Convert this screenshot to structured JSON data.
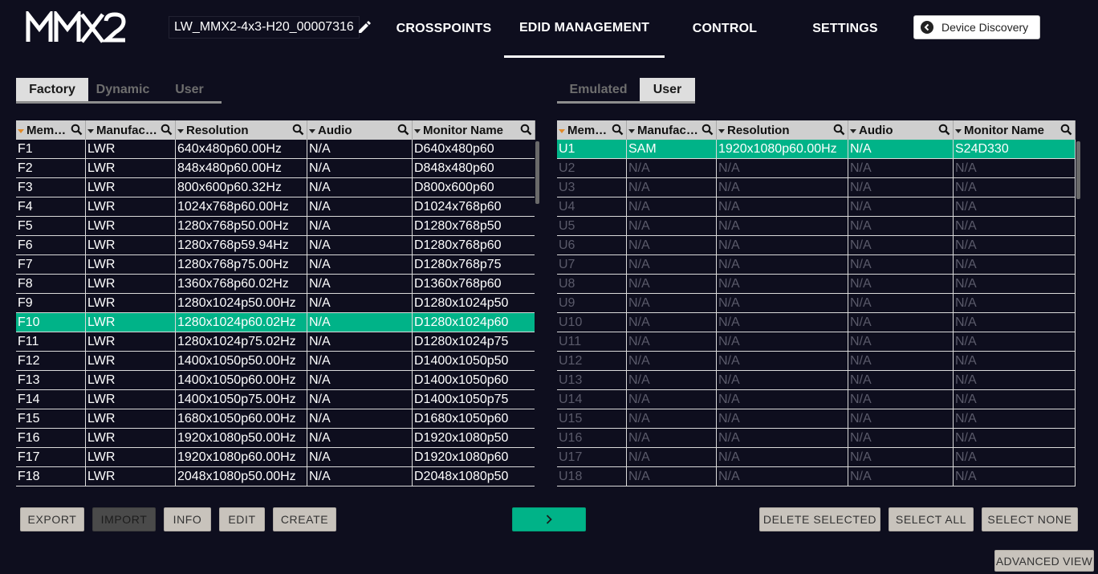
{
  "header": {
    "logo_text": "MMX2",
    "device_name": "LW_MMX2-4x3-H20_00007316",
    "nav": [
      "CROSSPOINTS",
      "EDID MANAGEMENT",
      "CONTROL",
      "SETTINGS"
    ],
    "active_nav": "EDID MANAGEMENT",
    "discovery_label": "Device Discovery"
  },
  "left_panel": {
    "tabs": [
      "Factory",
      "Dynamic",
      "User"
    ],
    "active_tab": "Factory",
    "columns": [
      "Mem…",
      "Manufac…",
      "Resolution",
      "Audio",
      "Monitor Name"
    ],
    "rows": [
      [
        "F1",
        "LWR",
        "640x480p60.00Hz",
        "N/A",
        "D640x480p60"
      ],
      [
        "F2",
        "LWR",
        "848x480p60.00Hz",
        "N/A",
        "D848x480p60"
      ],
      [
        "F3",
        "LWR",
        "800x600p60.32Hz",
        "N/A",
        "D800x600p60"
      ],
      [
        "F4",
        "LWR",
        "1024x768p60.00Hz",
        "N/A",
        "D1024x768p60"
      ],
      [
        "F5",
        "LWR",
        "1280x768p50.00Hz",
        "N/A",
        "D1280x768p50"
      ],
      [
        "F6",
        "LWR",
        "1280x768p59.94Hz",
        "N/A",
        "D1280x768p60"
      ],
      [
        "F7",
        "LWR",
        "1280x768p75.00Hz",
        "N/A",
        "D1280x768p75"
      ],
      [
        "F8",
        "LWR",
        "1360x768p60.02Hz",
        "N/A",
        "D1360x768p60"
      ],
      [
        "F9",
        "LWR",
        "1280x1024p50.00Hz",
        "N/A",
        "D1280x1024p50"
      ],
      [
        "F10",
        "LWR",
        "1280x1024p60.02Hz",
        "N/A",
        "D1280x1024p60"
      ],
      [
        "F11",
        "LWR",
        "1280x1024p75.02Hz",
        "N/A",
        "D1280x1024p75"
      ],
      [
        "F12",
        "LWR",
        "1400x1050p50.00Hz",
        "N/A",
        "D1400x1050p50"
      ],
      [
        "F13",
        "LWR",
        "1400x1050p60.00Hz",
        "N/A",
        "D1400x1050p60"
      ],
      [
        "F14",
        "LWR",
        "1400x1050p75.00Hz",
        "N/A",
        "D1400x1050p75"
      ],
      [
        "F15",
        "LWR",
        "1680x1050p60.00Hz",
        "N/A",
        "D1680x1050p60"
      ],
      [
        "F16",
        "LWR",
        "1920x1080p50.00Hz",
        "N/A",
        "D1920x1080p50"
      ],
      [
        "F17",
        "LWR",
        "1920x1080p60.00Hz",
        "N/A",
        "D1920x1080p60"
      ],
      [
        "F18",
        "LWR",
        "2048x1080p50.00Hz",
        "N/A",
        "D2048x1080p50"
      ]
    ],
    "selected_row": "F10"
  },
  "right_panel": {
    "tabs": [
      "Emulated",
      "User"
    ],
    "active_tab": "User",
    "columns": [
      "Mem…",
      "Manufac…",
      "Resolution",
      "Audio",
      "Monitor Name"
    ],
    "rows": [
      [
        "U1",
        "SAM",
        "1920x1080p60.00Hz",
        "N/A",
        "S24D330"
      ],
      [
        "U2",
        "N/A",
        "N/A",
        "N/A",
        "N/A"
      ],
      [
        "U3",
        "N/A",
        "N/A",
        "N/A",
        "N/A"
      ],
      [
        "U4",
        "N/A",
        "N/A",
        "N/A",
        "N/A"
      ],
      [
        "U5",
        "N/A",
        "N/A",
        "N/A",
        "N/A"
      ],
      [
        "U6",
        "N/A",
        "N/A",
        "N/A",
        "N/A"
      ],
      [
        "U7",
        "N/A",
        "N/A",
        "N/A",
        "N/A"
      ],
      [
        "U8",
        "N/A",
        "N/A",
        "N/A",
        "N/A"
      ],
      [
        "U9",
        "N/A",
        "N/A",
        "N/A",
        "N/A"
      ],
      [
        "U10",
        "N/A",
        "N/A",
        "N/A",
        "N/A"
      ],
      [
        "U11",
        "N/A",
        "N/A",
        "N/A",
        "N/A"
      ],
      [
        "U12",
        "N/A",
        "N/A",
        "N/A",
        "N/A"
      ],
      [
        "U13",
        "N/A",
        "N/A",
        "N/A",
        "N/A"
      ],
      [
        "U14",
        "N/A",
        "N/A",
        "N/A",
        "N/A"
      ],
      [
        "U15",
        "N/A",
        "N/A",
        "N/A",
        "N/A"
      ],
      [
        "U16",
        "N/A",
        "N/A",
        "N/A",
        "N/A"
      ],
      [
        "U17",
        "N/A",
        "N/A",
        "N/A",
        "N/A"
      ],
      [
        "U18",
        "N/A",
        "N/A",
        "N/A",
        "N/A"
      ]
    ],
    "selected_row": "U1"
  },
  "buttons": {
    "export": "EXPORT",
    "import": "IMPORT",
    "info": "INFO",
    "edit": "EDIT",
    "create": "CREATE",
    "transfer_icon": "chevron-right-icon",
    "delete_selected": "DELETE SELECTED",
    "select_all": "SELECT ALL",
    "select_none": "SELECT NONE",
    "advanced_view": "ADVANCED VIEW"
  },
  "colors": {
    "background": "#0e0e1e",
    "accent": "#00b388",
    "header_bg": "#cfcfcf",
    "button_bg": "#c8c3bc",
    "sort_arrow": "#e08a2a"
  }
}
